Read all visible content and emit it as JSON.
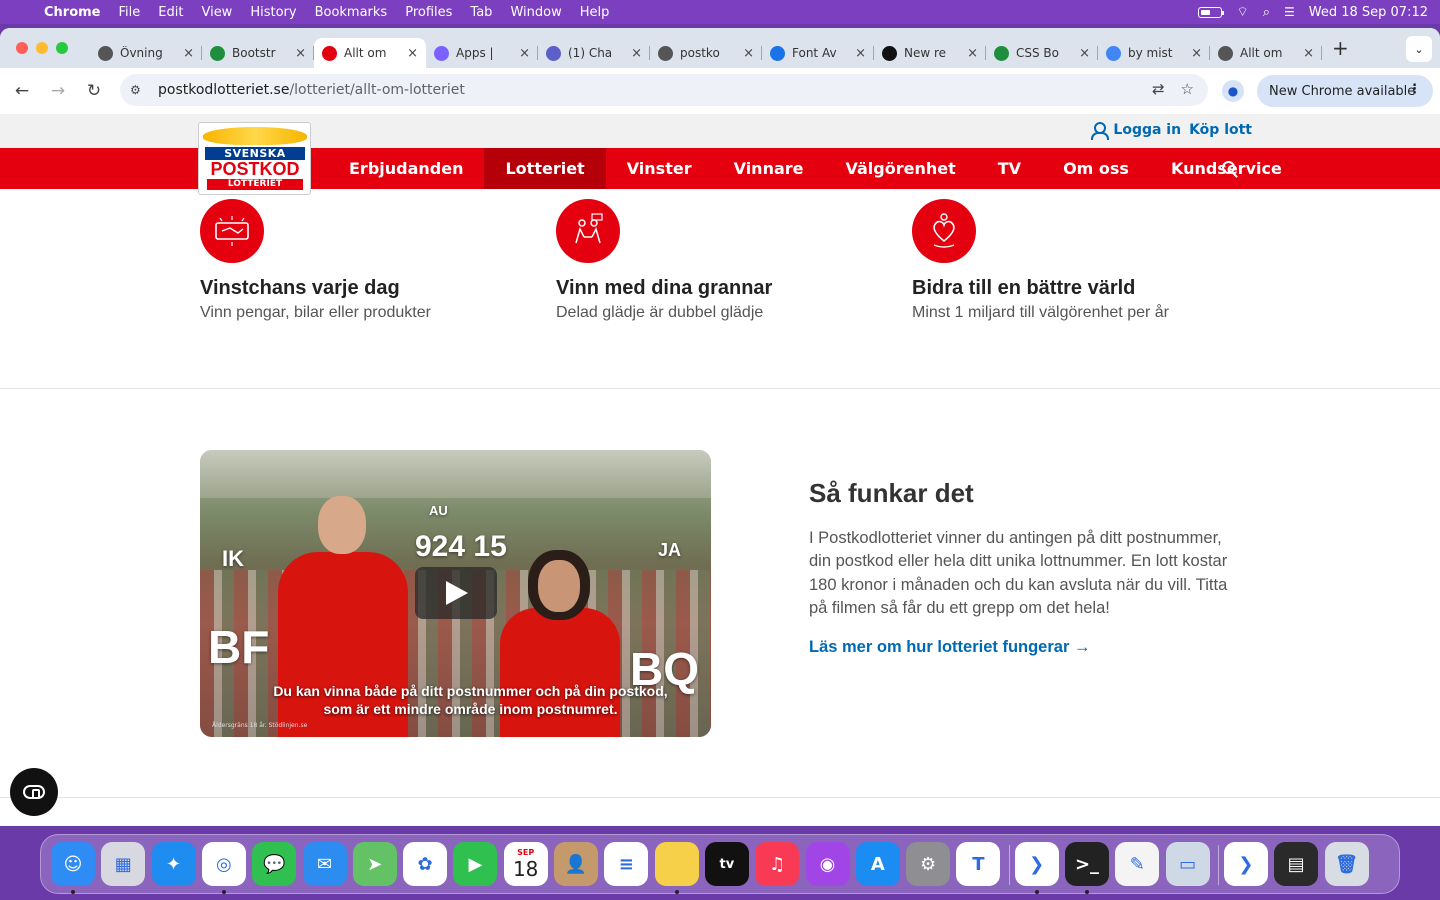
{
  "menubar": {
    "app_name": "Chrome",
    "items": [
      "File",
      "Edit",
      "View",
      "History",
      "Bookmarks",
      "Profiles",
      "Tab",
      "Window",
      "Help"
    ],
    "datetime": "Wed 18 Sep  07:12"
  },
  "tabs": [
    {
      "title": "Övning",
      "favicon": "globe-icon",
      "color": "#555"
    },
    {
      "title": "Bootstr",
      "favicon": "w-icon",
      "color": "#1e8e3e"
    },
    {
      "title": "Allt om",
      "favicon": "postkod-icon",
      "color": "#e4000f",
      "active": true
    },
    {
      "title": "Apps |",
      "favicon": "copilot-icon",
      "color": "#7b61ff"
    },
    {
      "title": "(1) Cha",
      "favicon": "teams-icon",
      "color": "#5b5fc7"
    },
    {
      "title": "postko",
      "favicon": "globe-icon",
      "color": "#555"
    },
    {
      "title": "Font Av",
      "favicon": "flag-icon",
      "color": "#1a73e8"
    },
    {
      "title": "New re",
      "favicon": "github-icon",
      "color": "#111"
    },
    {
      "title": "CSS Bo",
      "favicon": "w-icon",
      "color": "#1e8e3e"
    },
    {
      "title": "by mist",
      "favicon": "google-icon",
      "color": "#4285f4"
    },
    {
      "title": "Allt om",
      "favicon": "globe-icon",
      "color": "#555"
    }
  ],
  "toolbar": {
    "url_host": "postkodlotteriet.se",
    "url_path": "/lotteriet/allt-om-lotteriet",
    "update_label": "New Chrome available"
  },
  "site": {
    "logo": {
      "line1": "SVENSKA",
      "line2": "POSTKOD",
      "line3": "LOTTERIET"
    },
    "login_label": "Logga in",
    "buy_label": "Köp lott",
    "nav": [
      "Erbjudanden",
      "Lotteriet",
      "Vinster",
      "Vinnare",
      "Välgörenhet",
      "TV",
      "Om oss",
      "Kundservice"
    ],
    "nav_active": "Lotteriet",
    "brand_red": "#e4000f",
    "link_blue": "#0069b4"
  },
  "features": [
    {
      "icon": "ticket-icon",
      "title": "Vinstchans varje dag",
      "subtitle": "Vinn pengar, bilar eller produkter"
    },
    {
      "icon": "neighbors-icon",
      "title": "Vinn med dina grannar",
      "subtitle": "Delad glädje är dubbel glädje"
    },
    {
      "icon": "heart-hands-icon",
      "title": "Bidra till en bättre värld",
      "subtitle": "Minst 1 miljard till välgörenhet per år"
    }
  ],
  "video": {
    "labels": {
      "ik": "IK",
      "au": "AU",
      "number": "924 15",
      "ja": "JA",
      "bf": "BF",
      "bq": "BQ"
    },
    "caption_line1": "Du kan vinna både på ditt postnummer och på din postkod,",
    "caption_line2": "som är ett mindre område inom postnumret.",
    "disclaimer": "Åldersgräns 18 år. Stödlinjen.se"
  },
  "howto": {
    "title": "Så funkar det",
    "body": "I Postkodlotteriet vinner du antingen på ditt postnummer, din postkod eller hela ditt unika lottnummer. En lott kostar 180 kronor i månaden och du kan avsluta när du vill. Titta på filmen så får du ett grepp om det hela!",
    "link": "Läs mer om hur lotteriet fungerar →"
  },
  "dock": {
    "calendar_month": "SEP",
    "calendar_day": "18",
    "apps": [
      "finder",
      "launchpad",
      "safari",
      "chrome",
      "messages",
      "mail",
      "maps",
      "photos",
      "facetime",
      "calendar",
      "contacts",
      "reminders",
      "notes",
      "tv",
      "music",
      "podcasts",
      "app-store",
      "system-settings",
      "teams",
      "vscode",
      "terminal",
      "textedit",
      "preview",
      "vscode-2",
      "screen",
      "trash"
    ]
  }
}
